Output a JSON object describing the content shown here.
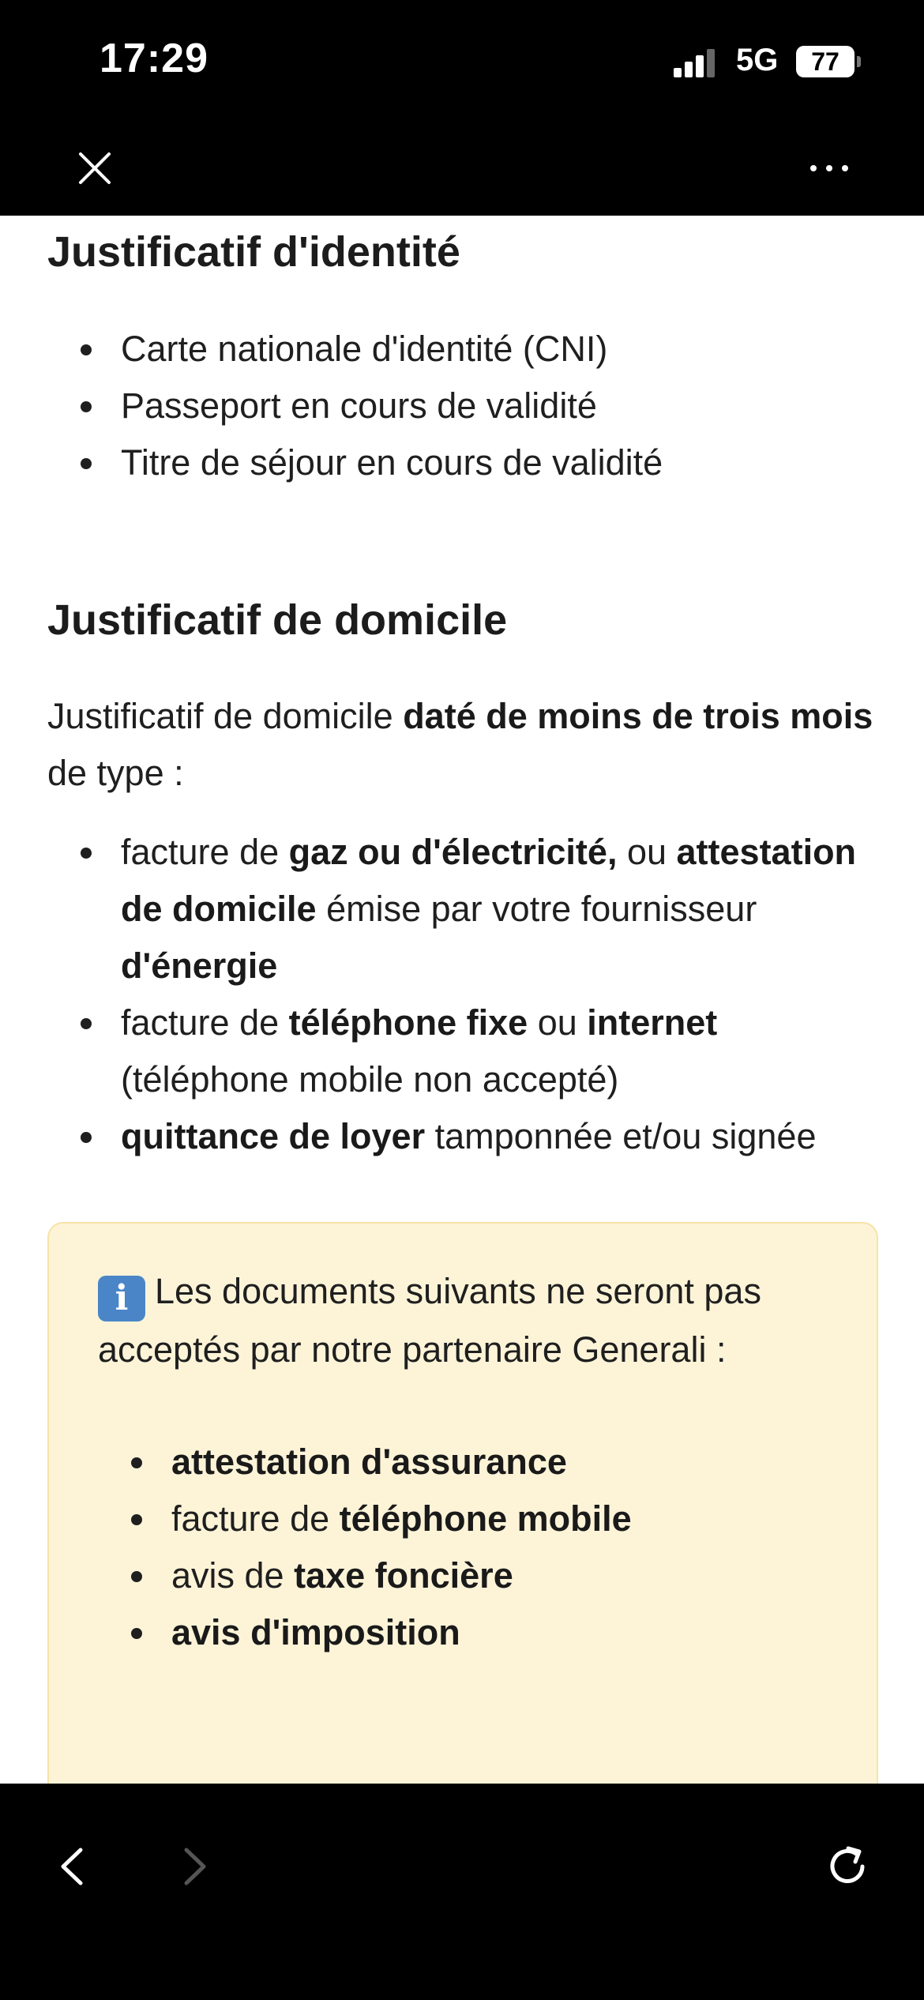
{
  "status": {
    "time": "17:29",
    "network": "5G",
    "battery": "77"
  },
  "section_identity": {
    "title": "Justificatif d'identité",
    "items": [
      "Carte nationale d'identité (CNI)",
      "Passeport en cours de validité",
      "Titre de séjour en cours de validité"
    ]
  },
  "section_domicile": {
    "title": "Justificatif de domicile",
    "intro_1": "Justificatif de domicile ",
    "intro_bold": "daté de moins de trois mois",
    "intro_2": " de type :",
    "item1": {
      "t1": "facture de ",
      "b1": "gaz ou d'électricité,",
      "t2": " ou ",
      "b2": "attestation de domicile",
      "t3": " émise par votre fournisseur ",
      "b3": "d'énergie"
    },
    "item2": {
      "t1": "facture de ",
      "b1": "téléphone fixe",
      "t2": " ou ",
      "b2": "internet",
      "t3": " (téléphone mobile non accepté)"
    },
    "item3": {
      "b1": "quittance de loyer",
      "t1": " tamponnée et/ou signée"
    }
  },
  "notice": {
    "icon": "info-icon",
    "icon_glyph": "i",
    "text": "Les documents suivants ne seront pas acceptés par notre partenaire Generali :",
    "item1": {
      "b": "attestation d'assurance"
    },
    "item2": {
      "t": "facture de ",
      "b": "téléphone mobile"
    },
    "item3": {
      "t": "avis de ",
      "b": "taxe foncière"
    },
    "item4": {
      "b": "avis d'imposition"
    }
  }
}
